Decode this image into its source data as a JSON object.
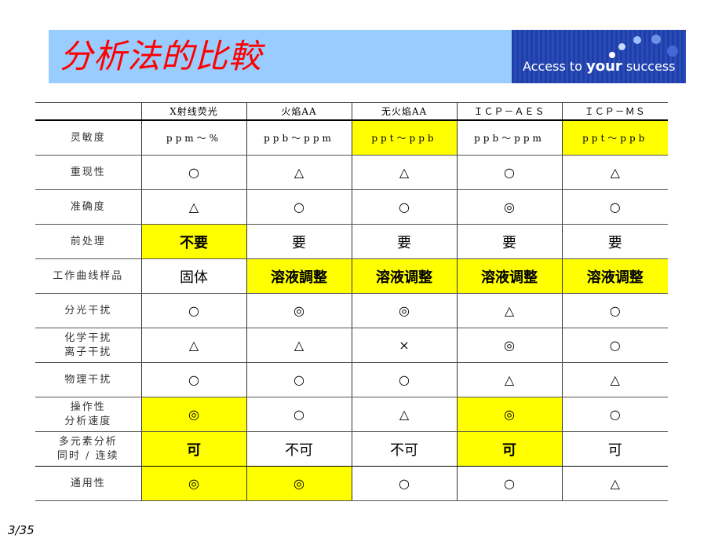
{
  "header": {
    "title": "分析法的比較",
    "logo_text_pre": "Access to ",
    "logo_text_bold": "your",
    "logo_text_post": " success"
  },
  "colors": {
    "highlight": "#ffff00",
    "title": "#ff0000",
    "banner": "#99ccff",
    "logo": "#1f3fa8"
  },
  "table": {
    "columns": [
      "",
      "X射线荧光",
      "火焰AA",
      "无火焰AA",
      "ＩＣＰ－ＡＥＳ",
      "ＩＣＰ－ＭＳ"
    ],
    "rows": [
      {
        "label": "灵敏度",
        "cells": [
          "ppm～%",
          "ppb～ppm",
          "ppt～ppb",
          "ppb～ppm",
          "ppt～ppb"
        ],
        "highlight": [
          false,
          false,
          true,
          false,
          true
        ]
      },
      {
        "label": "重现性",
        "cells": [
          "○",
          "△",
          "△",
          "○",
          "△"
        ],
        "highlight": [
          false,
          false,
          false,
          false,
          false
        ]
      },
      {
        "label": "准确度",
        "cells": [
          "△",
          "○",
          "○",
          "◎",
          "○"
        ],
        "highlight": [
          false,
          false,
          false,
          false,
          false
        ]
      },
      {
        "label": "前处理",
        "cells": [
          "不要",
          "要",
          "要",
          "要",
          "要"
        ],
        "highlight": [
          true,
          false,
          false,
          false,
          false
        ]
      },
      {
        "label": "工作曲线样品",
        "cells": [
          "固体",
          "溶液調整",
          "溶液调整",
          "溶液调整",
          "溶液调整"
        ],
        "highlight": [
          false,
          true,
          true,
          true,
          true
        ]
      },
      {
        "label": "分光干扰",
        "cells": [
          "○",
          "◎",
          "◎",
          "△",
          "○"
        ],
        "highlight": [
          false,
          false,
          false,
          false,
          false
        ]
      },
      {
        "label": "化学干扰\n离子干扰",
        "cells": [
          "△",
          "△",
          "×",
          "◎",
          "○"
        ],
        "highlight": [
          false,
          false,
          false,
          false,
          false
        ]
      },
      {
        "label": "物理干扰",
        "cells": [
          "○",
          "○",
          "○",
          "△",
          "△"
        ],
        "highlight": [
          false,
          false,
          false,
          false,
          false
        ]
      },
      {
        "label": "操作性\n分析速度",
        "cells": [
          "◎",
          "○",
          "△",
          "◎",
          "○"
        ],
        "highlight": [
          true,
          false,
          false,
          true,
          false
        ]
      },
      {
        "label": "多元素分析\n同时 / 连续",
        "cells": [
          "可",
          "不可",
          "不可",
          "可",
          "可"
        ],
        "highlight": [
          true,
          false,
          false,
          true,
          false
        ]
      },
      {
        "label": "通用性",
        "cells": [
          "◎",
          "◎",
          "○",
          "○",
          "△"
        ],
        "highlight": [
          true,
          true,
          false,
          false,
          false
        ]
      }
    ]
  },
  "footer": {
    "page": "3/35"
  }
}
